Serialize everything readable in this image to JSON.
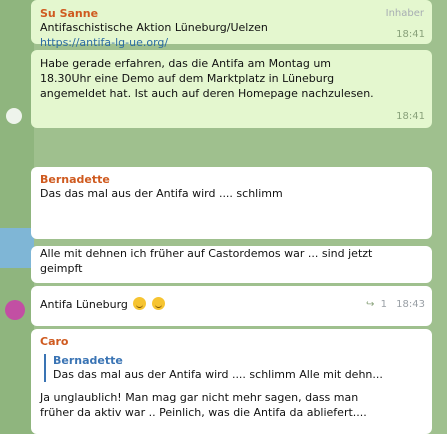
{
  "messages": [
    {
      "sender": "Su Sanne",
      "role": "Inhaber",
      "lines": [
        "Antifaschistische Aktion Lüneburg/Uelzen",
        "https://antifa-lg-ue.org/"
      ],
      "time": "18:41"
    },
    {
      "lines": [
        "Habe gerade erfahren, das die Antifa am Montag um",
        "18.30Uhr eine Demo auf dem Marktplatz in Lüneburg",
        "angemeldet hat. Ist auch auf deren Homepage nachzulesen."
      ],
      "time": "18:41"
    },
    {
      "sender": "Bernadette",
      "lines": [
        "Das das mal aus der Antifa wird .... schlimm",
        "Alle mit dehnen ich früher auf Castordemos war ... sind jetzt",
        "geimpft"
      ]
    },
    {
      "text": "Antifa Lüneburg",
      "emoji_names": [
        "tired-face-emoji",
        "tired-face-emoji"
      ],
      "share_icon": "share-icon",
      "views": "1",
      "time": "18:43"
    },
    {
      "sender": "Caro",
      "reply": {
        "sender": "Bernadette",
        "text": "Das das mal aus der Antifa wird .... schlimm   Alle mit dehn..."
      },
      "lines": [
        "Ja unglaublich! Man mag gar nicht mehr sagen, dass man",
        "früher da aktiv war .. Peinlich, was die Antifa da abliefert...."
      ]
    }
  ],
  "colors": {
    "background": "#9fc08e",
    "bubble_green": "#e4f7cf",
    "bubble_white": "#ffffff",
    "name_orange": "#cf5a1f",
    "name_blue": "#3a74b4"
  }
}
